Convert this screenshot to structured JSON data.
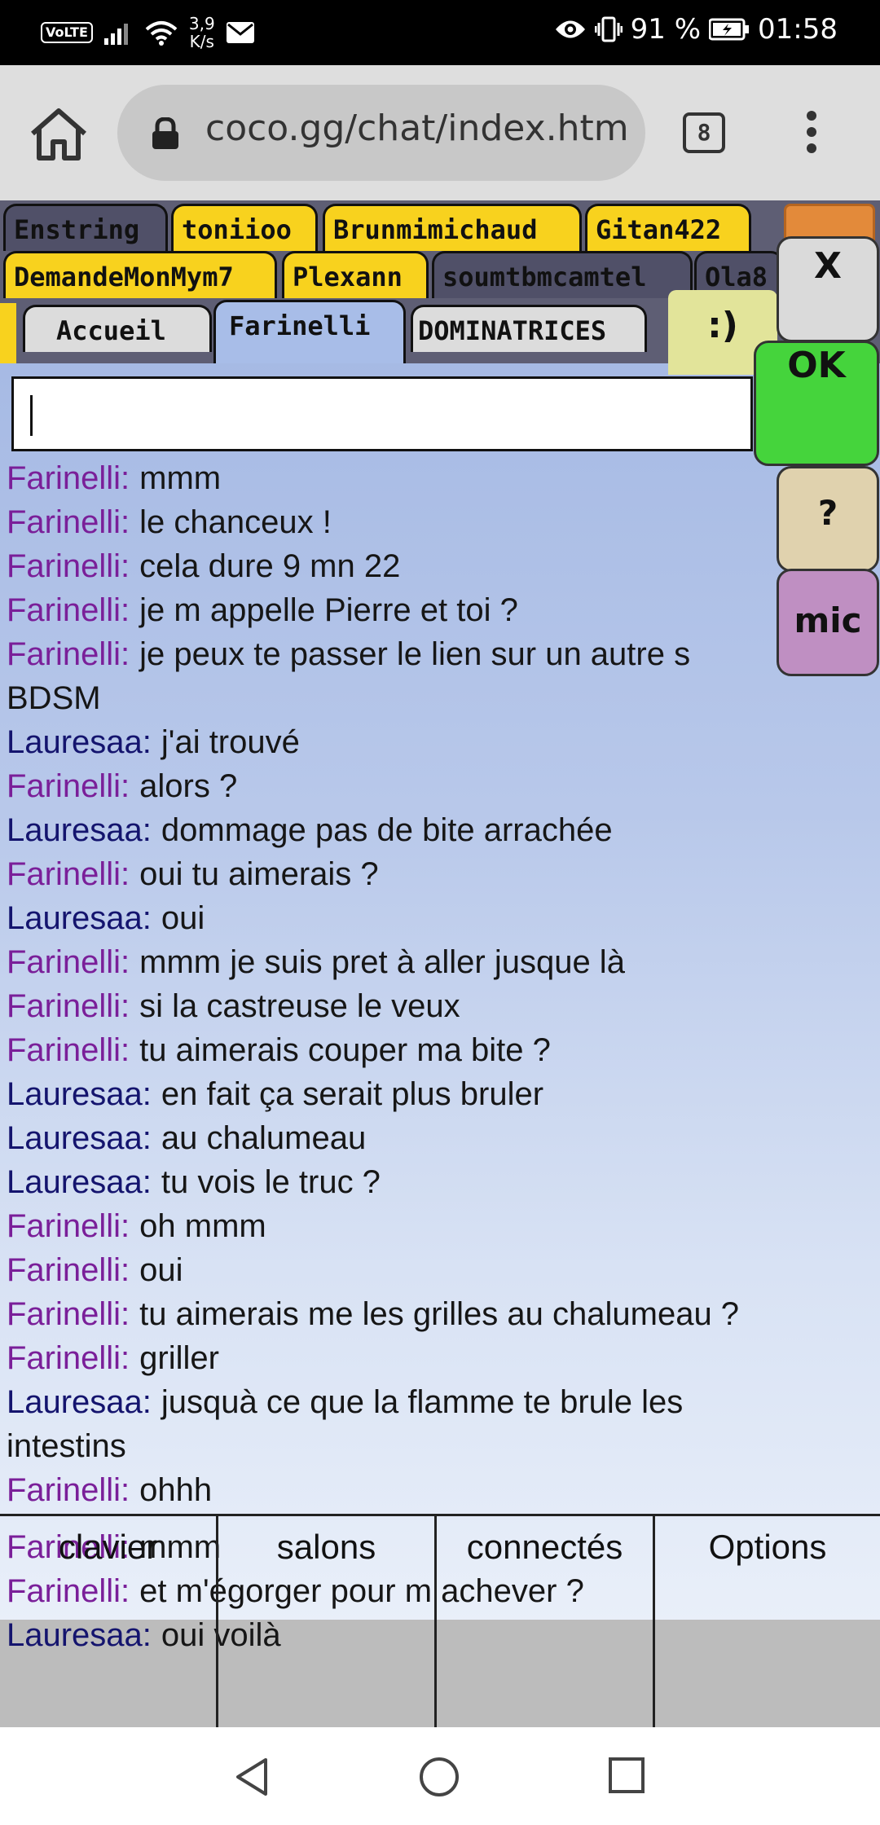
{
  "status_bar": {
    "volte": "VoLTE",
    "net_speed_value": "3,9",
    "net_speed_unit": "K/s",
    "battery_percent": "91 %",
    "time": "01:58",
    "icons": [
      "volte-icon",
      "signal-icon",
      "wifi-icon",
      "mail-icon",
      "eye-icon",
      "vibrate-icon",
      "battery-icon"
    ]
  },
  "browser": {
    "url": "coco.gg/chat/index.htm",
    "tab_count": "8",
    "icons": [
      "home-icon",
      "lock-icon",
      "menu-icon"
    ]
  },
  "private_tabs": {
    "row1": [
      "Enstring",
      "toniioo",
      "Brunmimichaud",
      "Gitan422"
    ],
    "row2": [
      "DemandeMonMym7",
      "Plexann",
      "soumtbmcamtel",
      "Ola8"
    ],
    "row3": [
      "Accueil",
      "Farinelli",
      "DOMINATRICES"
    ]
  },
  "smiley_label": ":)",
  "side_buttons": {
    "close": "X",
    "ok": "OK",
    "help": "?",
    "mic": "mic"
  },
  "chat": [
    {
      "user": "Farinelli:",
      "text": "mmm"
    },
    {
      "user": "Farinelli:",
      "text": "le chanceux !"
    },
    {
      "user": "Farinelli:",
      "text": "cela dure 9 mn 22"
    },
    {
      "user": "Farinelli:",
      "text": "je m appelle Pierre et toi ?"
    },
    {
      "user": "Farinelli:",
      "text": "je peux te passer le lien sur un autre s"
    },
    {
      "user": "",
      "text": "BDSM"
    },
    {
      "user": "Lauresaa:",
      "text": "j'ai trouvé"
    },
    {
      "user": "Farinelli:",
      "text": "alors ?"
    },
    {
      "user": "Lauresaa:",
      "text": "dommage pas de bite arrachée"
    },
    {
      "user": "Farinelli:",
      "text": "oui tu aimerais ?"
    },
    {
      "user": "Lauresaa:",
      "text": "oui"
    },
    {
      "user": "Farinelli:",
      "text": "mmm je suis pret à aller jusque là"
    },
    {
      "user": "Farinelli:",
      "text": "si la castreuse le veux"
    },
    {
      "user": "Farinelli:",
      "text": "tu aimerais couper ma bite ?"
    },
    {
      "user": "Lauresaa:",
      "text": "en fait ça serait plus bruler"
    },
    {
      "user": "Lauresaa:",
      "text": "au chalumeau"
    },
    {
      "user": "Lauresaa:",
      "text": "tu vois le truc ?"
    },
    {
      "user": "Farinelli:",
      "text": "oh mmm"
    },
    {
      "user": "Farinelli:",
      "text": "oui"
    },
    {
      "user": "Farinelli:",
      "text": "tu aimerais me les grilles au chalumeau ?"
    },
    {
      "user": "Farinelli:",
      "text": "griller"
    },
    {
      "user": "Lauresaa:",
      "text": "jusquà ce que la flamme te brule les"
    },
    {
      "user": "",
      "text": "intestins"
    },
    {
      "user": "Farinelli:",
      "text": "ohhh"
    }
  ],
  "chat_overflow": [
    {
      "user": "Farinelli:",
      "text": "mmm"
    },
    {
      "user": "Farinelli:",
      "text": "et m'égorger pour m achever ?"
    },
    {
      "user": "Lauresaa:",
      "text": "oui voilà"
    }
  ],
  "bottom_nav": [
    "clavier",
    "salons",
    "connectés",
    "Options"
  ],
  "system_nav": [
    "back-icon",
    "home-circle-icon",
    "recents-icon"
  ]
}
